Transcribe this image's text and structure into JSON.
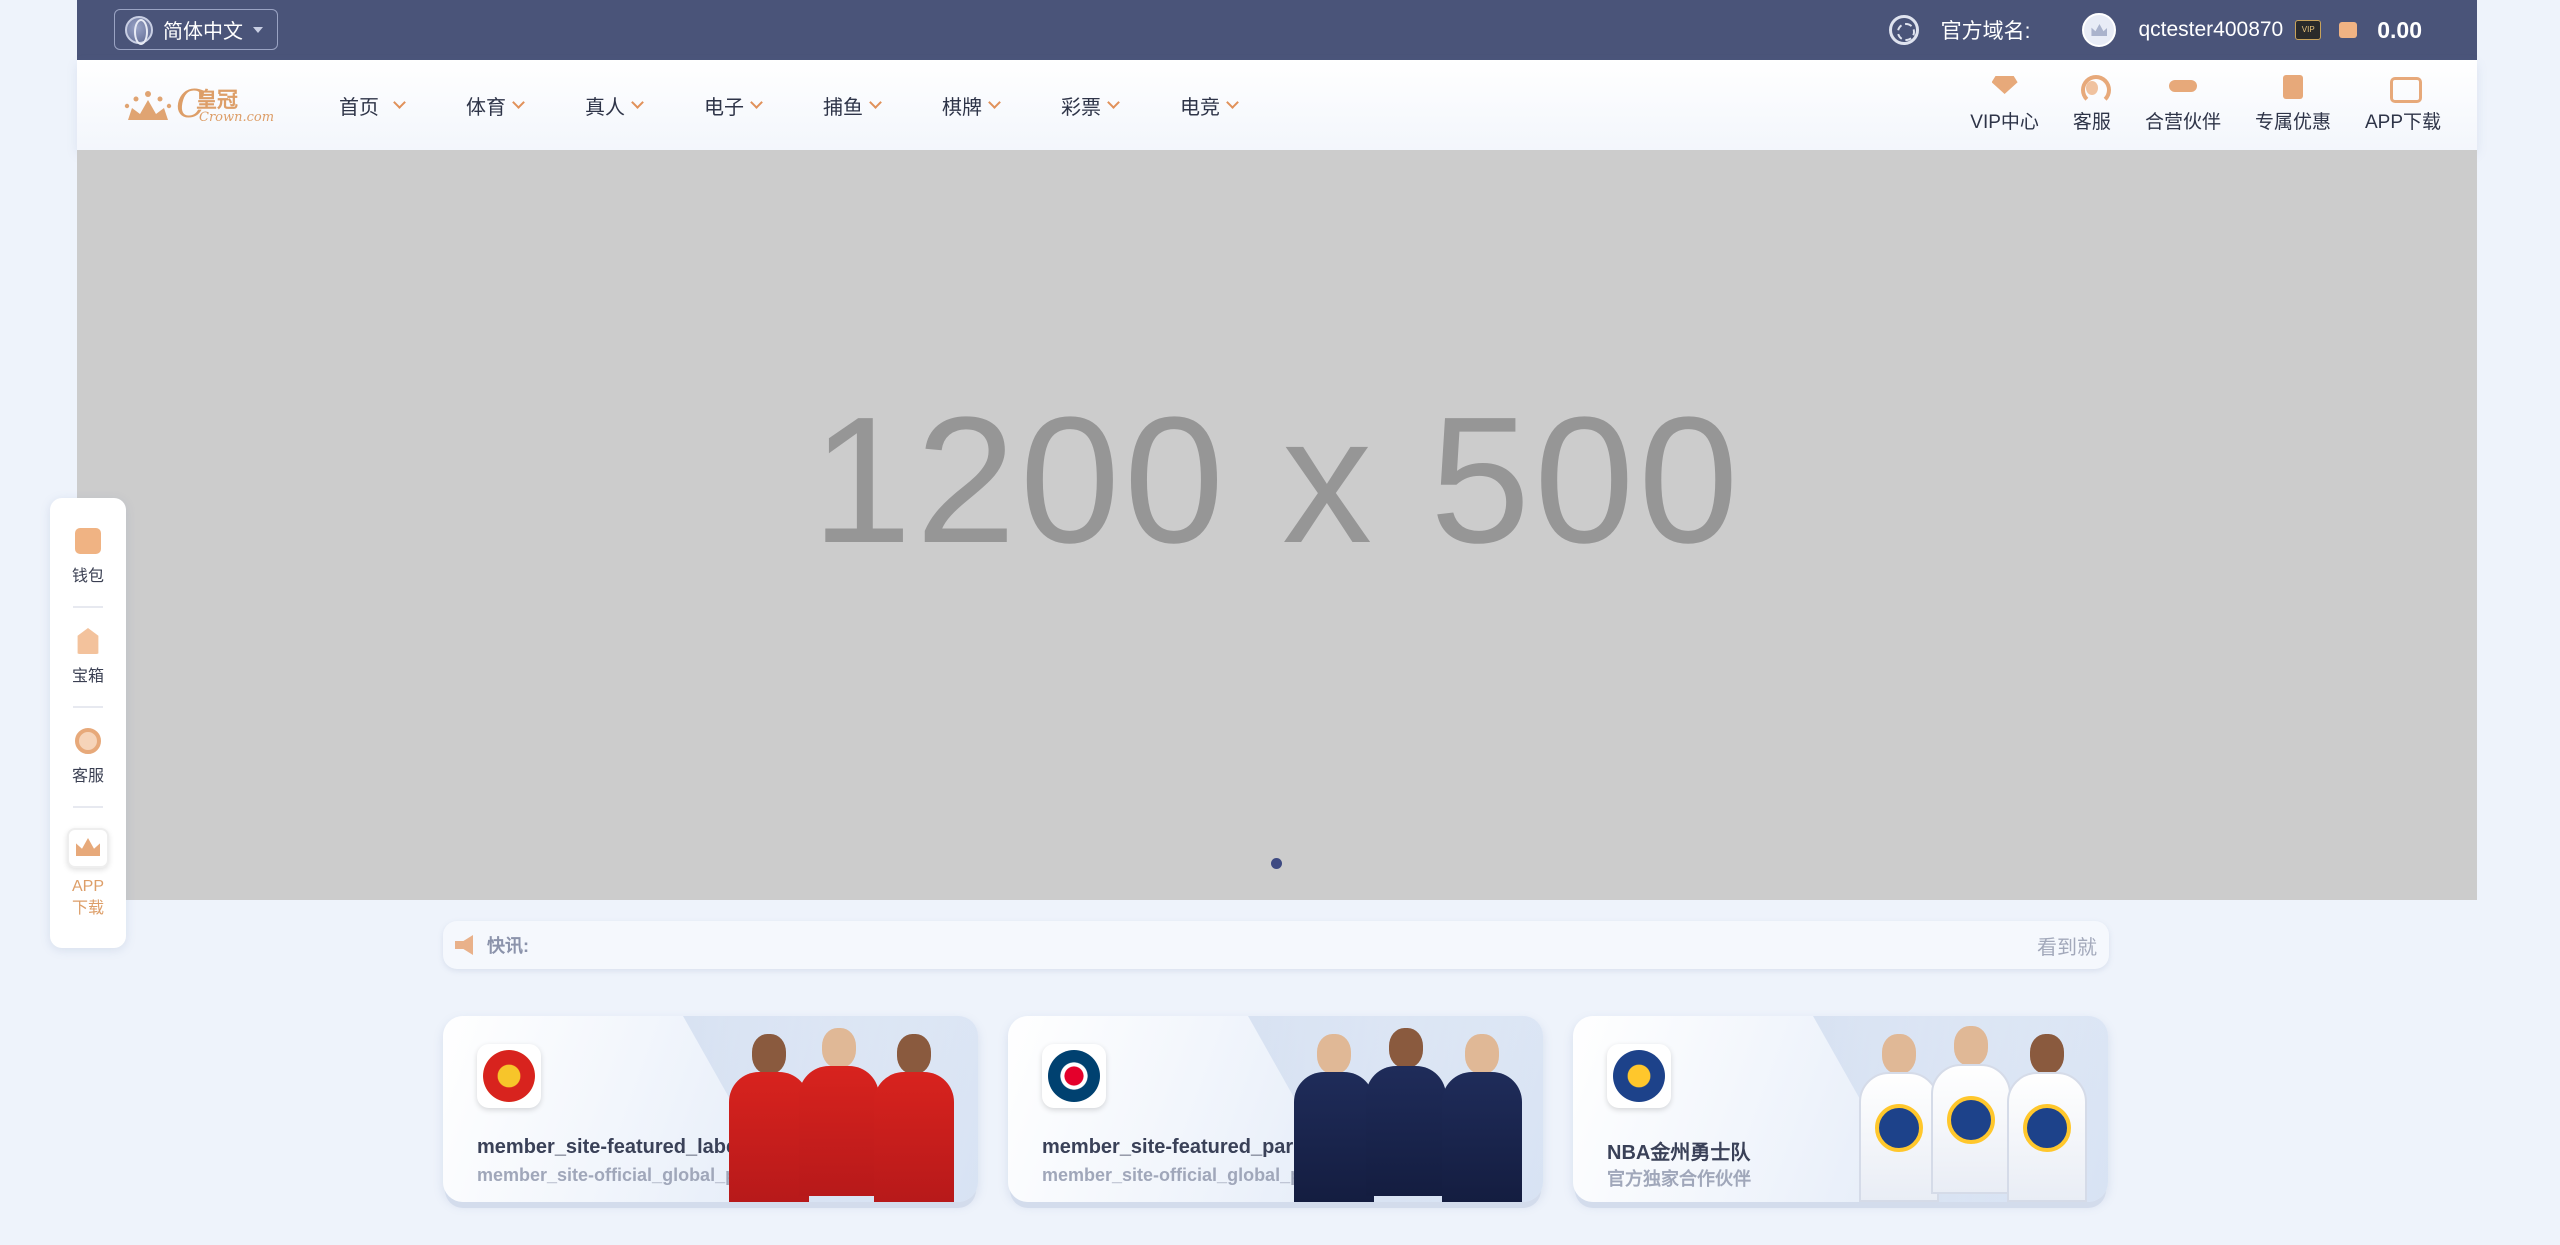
{
  "topbar": {
    "language": "简体中文",
    "domain_label": "官方域名:",
    "username": "qctester400870",
    "balance": "0.00"
  },
  "logo": {
    "brand_cn": "皇冠",
    "brand_en": "Crown.com"
  },
  "nav": {
    "items": [
      {
        "label": "首页"
      },
      {
        "label": "体育"
      },
      {
        "label": "真人"
      },
      {
        "label": "电子"
      },
      {
        "label": "捕鱼"
      },
      {
        "label": "棋牌"
      },
      {
        "label": "彩票"
      },
      {
        "label": "电竞"
      }
    ],
    "right_items": [
      {
        "label": "VIP中心",
        "icon": "vip-diamond-icon"
      },
      {
        "label": "客服",
        "icon": "customer-service-icon"
      },
      {
        "label": "合营伙伴",
        "icon": "handshake-icon"
      },
      {
        "label": "专属优惠",
        "icon": "gift-icon"
      },
      {
        "label": "APP下载",
        "icon": "app-download-icon"
      }
    ]
  },
  "banner": {
    "placeholder_text": "1200 x 500",
    "slide_count": 1
  },
  "side_float": {
    "wallet": "钱包",
    "treasure": "宝箱",
    "service": "客服",
    "app_line1": "APP",
    "app_line2": "下载"
  },
  "ticker": {
    "label": "快讯:",
    "message": "看到就"
  },
  "cards": [
    {
      "title": "member_site-featured_label_manchester",
      "subtitle": "member_site-official_global_partner"
    },
    {
      "title": "member_site-featured_paris_saint_germain",
      "subtitle": "member_site-official_global_partner"
    },
    {
      "title": "NBA金州勇士队",
      "subtitle": "官方独家合作伙伴"
    }
  ],
  "colors": {
    "topbar_bg": "#4a5479",
    "accent": "#dd9e68",
    "page_bg": "#eef3fb"
  }
}
